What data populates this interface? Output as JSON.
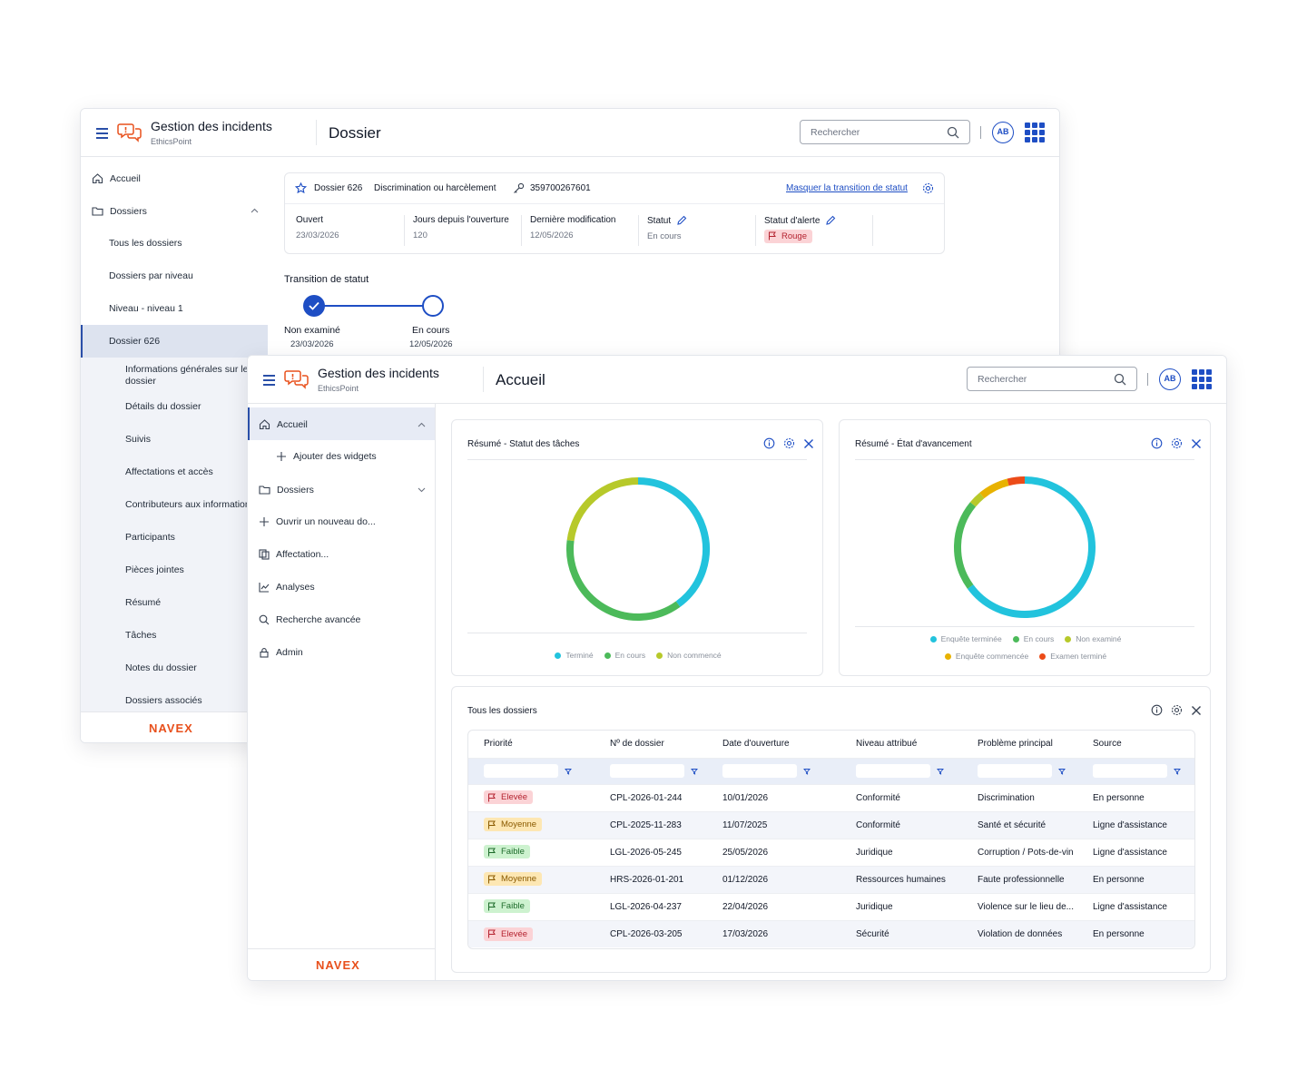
{
  "app": {
    "title": "Gestion des incidents",
    "subtitle": "EthicsPoint",
    "brand": "NAVEX"
  },
  "colors": {
    "accent": "#1e4ec4",
    "brand": "#e8501c"
  },
  "search": {
    "placeholder": "Rechercher"
  },
  "user": {
    "initials": "AB"
  },
  "back_window": {
    "page_title": "Dossier",
    "sidebar": {
      "home": "Accueil",
      "dossiers": "Dossiers",
      "items": [
        "Tous les dossiers",
        "Dossiers par niveau",
        "Niveau - niveau 1",
        "Dossier 626"
      ],
      "subitems": [
        "Informations générales sur le dossier",
        "Détails du dossier",
        "Suivis",
        "Affectations et accès",
        "Contributeurs aux informations",
        "Participants",
        "Pièces jointes",
        "Résumé",
        "Tâches",
        "Notes du dossier",
        "Dossiers associés"
      ]
    },
    "dossier": {
      "name": "Dossier 626",
      "category": "Discrimination ou harcèlement",
      "key": "359700267601",
      "link": "Masquer la transition de statut",
      "fields": [
        {
          "label": "Ouvert",
          "value": "23/03/2026"
        },
        {
          "label": "Jours depuis l'ouverture",
          "value": "120"
        },
        {
          "label": "Dernière modification",
          "value": "12/05/2026"
        },
        {
          "label": "Statut",
          "value": "En cours"
        },
        {
          "label": "Statut d'alerte",
          "value": "Rouge"
        }
      ]
    },
    "transition": {
      "title": "Transition de statut",
      "steps": [
        {
          "label": "Non examiné",
          "date": "23/03/2026",
          "done": true
        },
        {
          "label": "En cours",
          "date": "12/05/2026",
          "done": false
        }
      ]
    }
  },
  "front_window": {
    "page_title": "Accueil",
    "sidebar": {
      "home": "Accueil",
      "add_widgets": "Ajouter des widgets",
      "dossiers": "Dossiers",
      "new_dossier": "Ouvrir un nouveau do...",
      "affectation": "Affectation...",
      "analyses": "Analyses",
      "advanced_search": "Recherche avancée",
      "admin": "Admin"
    },
    "widgets": [
      {
        "title": "Résumé - Statut des tâches",
        "chart_data": {
          "type": "pie",
          "donut": true,
          "categories": [
            "Terminé",
            "En cours",
            "Non commencé"
          ],
          "values": [
            40,
            37,
            23
          ],
          "colors": [
            "#22c3dd",
            "#4cba5a",
            "#b7c92a"
          ]
        }
      },
      {
        "title": "Résumé - État d'avancement",
        "chart_data": {
          "type": "pie",
          "donut": true,
          "categories": [
            "Enquête terminée",
            "En cours",
            "Non examiné",
            "Enquête commencée",
            "Examen terminé"
          ],
          "values": [
            65,
            21,
            3,
            7,
            4
          ],
          "colors": [
            "#22c3dd",
            "#4cba5a",
            "#b7c92a",
            "#e8b200",
            "#ec4b18"
          ]
        }
      }
    ],
    "table": {
      "title": "Tous les dossiers",
      "columns": [
        "Priorité",
        "Nº de dossier",
        "Date d'ouverture",
        "Niveau attribué",
        "Problème principal",
        "Source"
      ],
      "rows": [
        {
          "priority": "Elevée",
          "level": "red",
          "id": "CPL-2026-01-244",
          "date": "10/01/2026",
          "niveau": "Conformité",
          "probleme": "Discrimination",
          "source": "En personne"
        },
        {
          "priority": "Moyenne",
          "level": "yellow",
          "id": "CPL-2025-11-283",
          "date": "11/07/2025",
          "niveau": "Conformité",
          "probleme": "Santé et sécurité",
          "source": "Ligne d'assistance"
        },
        {
          "priority": "Faible",
          "level": "green",
          "id": "LGL-2026-05-245",
          "date": "25/05/2026",
          "niveau": "Juridique",
          "probleme": "Corruption / Pots-de-vin",
          "source": "Ligne d'assistance"
        },
        {
          "priority": "Moyenne",
          "level": "yellow",
          "id": "HRS-2026-01-201",
          "date": "01/12/2026",
          "niveau": "Ressources humaines",
          "probleme": "Faute professionnelle",
          "source": "En personne"
        },
        {
          "priority": "Faible",
          "level": "green",
          "id": "LGL-2026-04-237",
          "date": "22/04/2026",
          "niveau": "Juridique",
          "probleme": "Violence sur le lieu de...",
          "source": "Ligne d'assistance"
        },
        {
          "priority": "Elevée",
          "level": "red",
          "id": "CPL-2026-03-205",
          "date": "17/03/2026",
          "niveau": "Sécurité",
          "probleme": "Violation de données",
          "source": "En personne"
        }
      ]
    }
  }
}
